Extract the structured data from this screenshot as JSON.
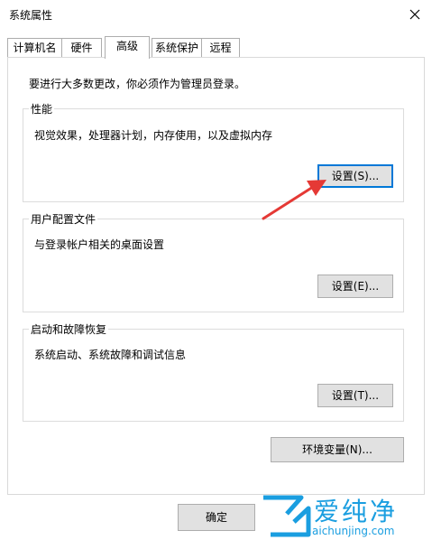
{
  "window": {
    "title": "系统属性"
  },
  "tabs": [
    {
      "label": "计算机名",
      "active": false
    },
    {
      "label": "硬件",
      "active": false
    },
    {
      "label": "高级",
      "active": true
    },
    {
      "label": "系统保护",
      "active": false
    },
    {
      "label": "远程",
      "active": false
    }
  ],
  "notice": "要进行大多数更改，你必须作为管理员登录。",
  "groups": {
    "performance": {
      "title": "性能",
      "desc": "视觉效果，处理器计划，内存使用，以及虚拟内存",
      "button": "设置(S)..."
    },
    "profile": {
      "title": "用户配置文件",
      "desc": "与登录帐户相关的桌面设置",
      "button": "设置(E)..."
    },
    "startup": {
      "title": "启动和故障恢复",
      "desc": "系统启动、系统故障和调试信息",
      "button": "设置(T)..."
    }
  },
  "env_button": "环境变量(N)...",
  "ok_button": "确定",
  "watermark": {
    "cn": "爱纯净",
    "en": "aichunjing.com"
  },
  "colors": {
    "annotation_arrow": "#e53935",
    "focus_border": "#0078d7",
    "watermark": "#1a9ee0"
  },
  "icons": {
    "close": "close-icon",
    "annotation": "red-arrow-icon",
    "watermark": "watermark-logo-icon"
  }
}
